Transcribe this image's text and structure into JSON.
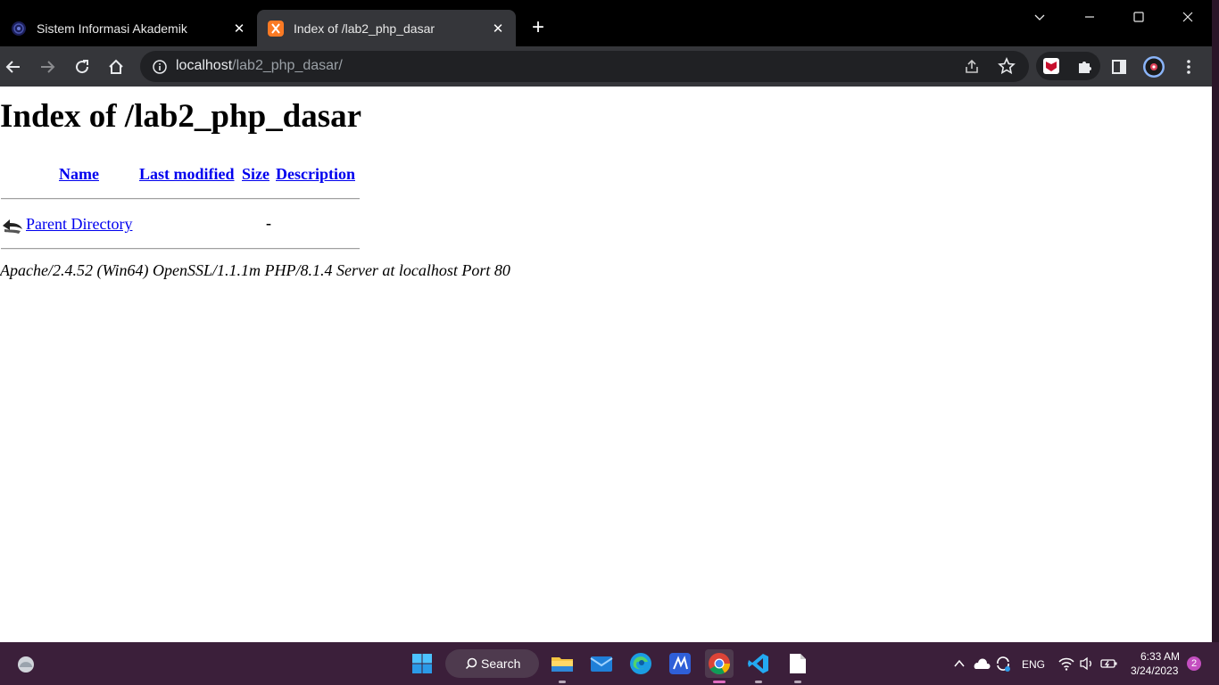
{
  "browser": {
    "tabs": [
      {
        "title": "Sistem Informasi Akademik",
        "active": false,
        "close": "✕"
      },
      {
        "title": "Index of /lab2_php_dasar",
        "active": true,
        "close": "✕"
      }
    ],
    "new_tab": "+",
    "address": {
      "host": "localhost",
      "path": "/lab2_php_dasar/"
    },
    "icons": [
      "back-icon",
      "forward-icon",
      "reload-icon",
      "home-icon",
      "info-icon",
      "share-icon",
      "star-icon",
      "mcafee-icon",
      "extensions-icon",
      "side-panel-icon",
      "profile-icon",
      "menu-icon"
    ]
  },
  "page": {
    "heading": "Index of /lab2_php_dasar",
    "columns": {
      "name": "Name",
      "last_modified": "Last modified",
      "size": "Size",
      "description": "Description"
    },
    "rows": [
      {
        "name": "Parent Directory",
        "size": "-"
      }
    ],
    "footer": "Apache/2.4.52 (Win64) OpenSSL/1.1.1m PHP/8.1.4 Server at localhost Port 80"
  },
  "taskbar": {
    "search_label": "Search",
    "language": "ENG",
    "time": "6:33 AM",
    "date": "3/24/2023",
    "notification_count": "2"
  },
  "colors": {
    "link": "#0000ee",
    "taskbar": "#3b1f3a",
    "toolbar": "#35363a",
    "tabstrip": "#000000"
  }
}
